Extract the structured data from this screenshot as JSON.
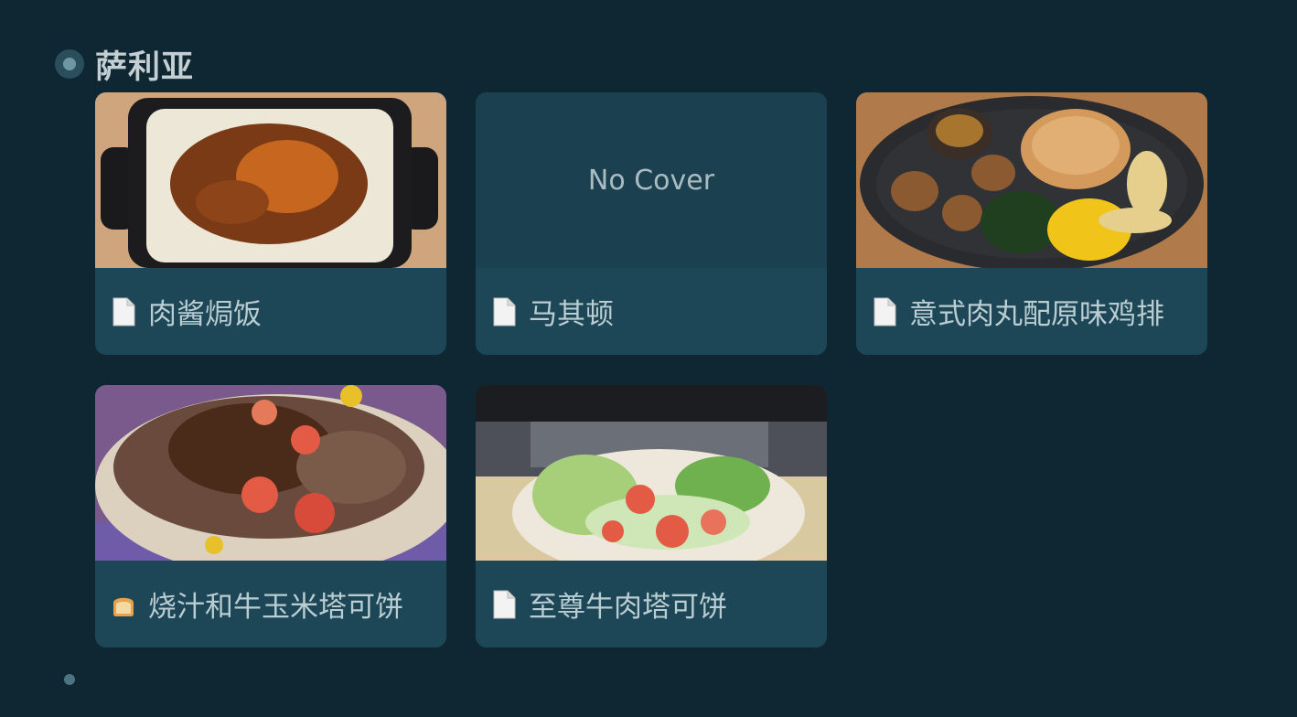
{
  "section": {
    "title": "萨利亚",
    "bullet_icon": "bullet-dot-icon"
  },
  "cards": [
    {
      "title": "肉酱焗饭",
      "icon": "file-icon",
      "has_cover": true,
      "cover_description_icon": "baked-rice-image"
    },
    {
      "title": "马其顿",
      "icon": "file-icon",
      "has_cover": false,
      "no_cover_text": "No Cover"
    },
    {
      "title": "意式肉丸配原味鸡排",
      "icon": "file-icon",
      "has_cover": true
    },
    {
      "title": "烧汁和牛玉米塔可饼",
      "icon": "bread-emoji-icon",
      "has_cover": true
    },
    {
      "title": "至尊牛肉塔可饼",
      "icon": "file-icon",
      "has_cover": true
    }
  ],
  "colors": {
    "background": "#0e2733",
    "card": "#1d4657",
    "title": "#c3cfd3",
    "card_text": "#b9cdd2"
  }
}
